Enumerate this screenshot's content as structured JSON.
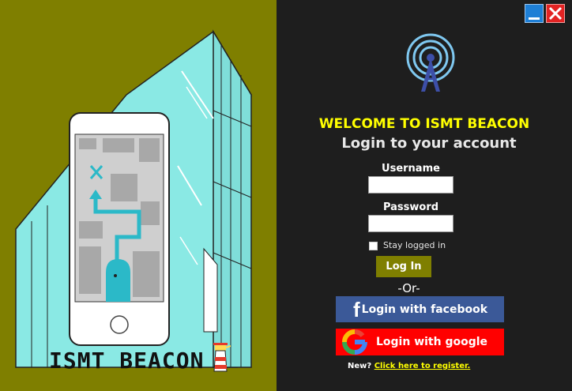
{
  "brand": {
    "name": "ISMT BEACON",
    "illustration_icon": "phone-map-illustration",
    "lighthouse_icon": "lighthouse-icon"
  },
  "window": {
    "minimize_icon": "minimize-icon",
    "close_icon": "close-icon"
  },
  "login": {
    "logo_icon": "broadcast-tower-icon",
    "welcome": "WELCOME TO ISMT BEACON",
    "subtitle": "Login to your account",
    "username_label": "Username",
    "username_value": "",
    "password_label": "Password",
    "password_value": "",
    "stay_logged_in": "Stay logged in",
    "stay_logged_in_checked": false,
    "login_button": "Log In",
    "or": "-Or-",
    "facebook_button": "Login with facebook",
    "google_button": "Login with google",
    "new_prompt": "New?",
    "register_link": "Click here to register."
  },
  "colors": {
    "left_panel": "#7f7f00",
    "right_panel": "#1e1e1e",
    "accent_yellow": "#ffff00",
    "facebook": "#3b5998",
    "google_bg": "#ff0000",
    "glass": "#8ae9e4",
    "character": "#2bb9c8"
  }
}
